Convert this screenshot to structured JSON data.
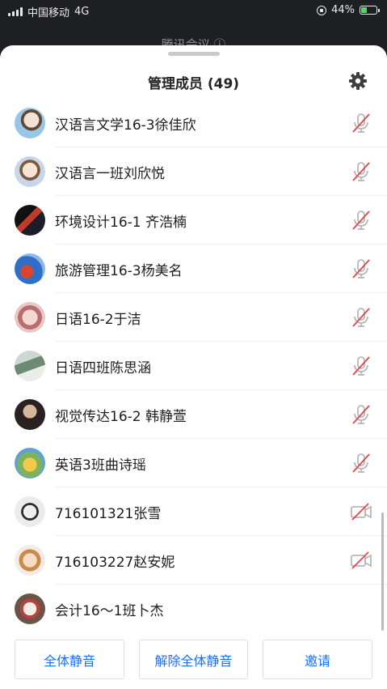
{
  "status_bar": {
    "carrier": "中国移动",
    "network": "4G",
    "battery": "44%",
    "battery_level": 0.44
  },
  "background_title": "腾讯会议 ⓘ",
  "header": {
    "title": "管理成员 (49)",
    "settings_icon": "gear-icon"
  },
  "members": [
    {
      "name": "汉语言文学16-3徐佳欣",
      "status_icon": "mic-muted-icon"
    },
    {
      "name": "汉语言一班刘欣悦",
      "status_icon": "mic-muted-icon"
    },
    {
      "name": "环境设计16-1 齐浩楠",
      "status_icon": "mic-muted-icon"
    },
    {
      "name": "旅游管理16-3杨美名",
      "status_icon": "mic-muted-icon"
    },
    {
      "name": "日语16-2于洁",
      "status_icon": "mic-muted-icon"
    },
    {
      "name": "日语四班陈思涵",
      "status_icon": "mic-muted-icon"
    },
    {
      "name": "视觉传达16-2 韩静萱",
      "status_icon": "mic-muted-icon"
    },
    {
      "name": "英语3班曲诗瑶",
      "status_icon": "mic-muted-icon"
    },
    {
      "name": "716101321张雪",
      "status_icon": "video-off-icon"
    },
    {
      "name": "716103227赵安妮",
      "status_icon": "video-off-icon"
    },
    {
      "name": "会计16～1班卜杰",
      "status_icon": "none"
    }
  ],
  "actions": {
    "mute_all": "全体静音",
    "unmute_all": "解除全体静音",
    "invite": "邀请"
  },
  "colors": {
    "accent": "#1d6ff2",
    "muted_red": "#e0474c",
    "icon_gray": "#b5b7bb"
  }
}
